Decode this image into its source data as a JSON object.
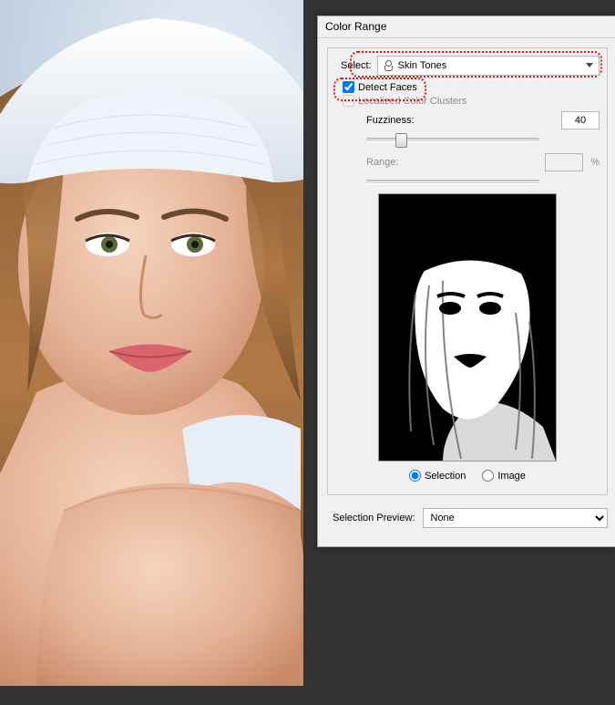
{
  "dialog": {
    "title": "Color Range",
    "select_label": "Select:",
    "select_value": "Skin Tones",
    "detect_faces": {
      "label": "Detect Faces",
      "checked": true
    },
    "localized": {
      "label": "Localized Color Clusters",
      "checked": false,
      "enabled": false
    },
    "fuzziness": {
      "label": "Fuzziness:",
      "value": "40",
      "pos_pct": 20
    },
    "range": {
      "label": "Range:",
      "value": "",
      "suffix": "%",
      "enabled": false
    },
    "preview_mode": {
      "selection": {
        "label": "Selection",
        "checked": true
      },
      "image": {
        "label": "Image",
        "checked": false
      }
    },
    "selection_preview": {
      "label": "Selection Preview:",
      "value": "None"
    }
  }
}
